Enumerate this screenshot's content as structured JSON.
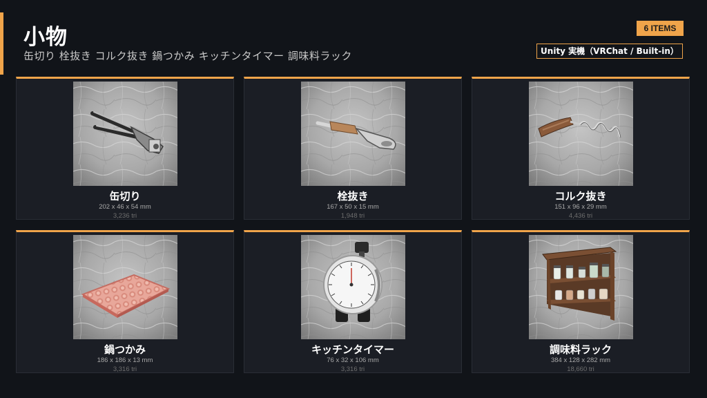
{
  "header": {
    "title": "小物",
    "subtitle": "缶切り 栓抜き コルク抜き 鍋つかみ キッチンタイマー 調味料ラック",
    "count_badge": "6 ITEMS",
    "platform_badge": "Unity 実機（VRChat / Built-in）"
  },
  "colors": {
    "accent": "#f0a44a",
    "background": "#111419",
    "card": "#1b1e25"
  },
  "items": [
    {
      "name": "缶切り",
      "dims": "202 x 46 x 54 mm",
      "tri": "3,236 tri",
      "icon": "can-opener-icon"
    },
    {
      "name": "栓抜き",
      "dims": "167 x 50 x 15 mm",
      "tri": "1,948 tri",
      "icon": "bottle-opener-icon"
    },
    {
      "name": "コルク抜き",
      "dims": "151 x 96 x 29 mm",
      "tri": "4,436 tri",
      "icon": "corkscrew-icon"
    },
    {
      "name": "鍋つかみ",
      "dims": "186 x 186 x 13 mm",
      "tri": "3,316 tri",
      "icon": "pot-holder-icon"
    },
    {
      "name": "キッチンタイマー",
      "dims": "76 x 32 x 106 mm",
      "tri": "3,316 tri",
      "icon": "kitchen-timer-icon"
    },
    {
      "name": "調味料ラック",
      "dims": "384 x 128 x 282 mm",
      "tri": "18,660 tri",
      "icon": "spice-rack-icon"
    }
  ]
}
